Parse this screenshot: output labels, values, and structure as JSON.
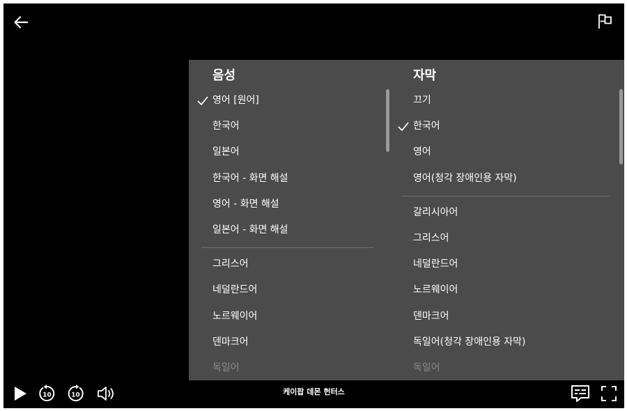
{
  "audio": {
    "title": "음성",
    "options": [
      {
        "label": "영어 [원어]",
        "selected": true
      },
      {
        "label": "한국어"
      },
      {
        "label": "일본어"
      },
      {
        "label": "한국어 - 화면 해설"
      },
      {
        "label": "영어 - 화면 해설"
      },
      {
        "label": "일본어 - 화면 해설"
      }
    ],
    "more_options": [
      {
        "label": "그리스어"
      },
      {
        "label": "네덜란드어"
      },
      {
        "label": "노르웨이어"
      },
      {
        "label": "덴마크어"
      },
      {
        "label": "독일어",
        "faded": true
      }
    ]
  },
  "subtitles": {
    "title": "자막",
    "options": [
      {
        "label": "끄기"
      },
      {
        "label": "한국어",
        "selected": true
      },
      {
        "label": "영어"
      },
      {
        "label": "영어(청각 장애인용 자막)"
      }
    ],
    "more_options": [
      {
        "label": "갈리시아어"
      },
      {
        "label": "그리스어"
      },
      {
        "label": "네덜란드어"
      },
      {
        "label": "노르웨이어"
      },
      {
        "label": "덴마크어"
      },
      {
        "label": "독일어(청각 장애인용 자막)"
      },
      {
        "label": "독일어",
        "faded": true
      }
    ]
  },
  "player": {
    "episode_title": "케이팝 데몬 헌터스",
    "rewind_seconds": "10",
    "forward_seconds": "10"
  },
  "icons": {
    "back": "arrow-left-icon",
    "flag": "flag-icon",
    "play": "play-icon",
    "rewind": "rewind-10-icon",
    "forward": "forward-10-icon",
    "volume": "volume-icon",
    "subtitles": "subtitles-icon",
    "fullscreen": "fullscreen-icon",
    "check": "check-icon"
  }
}
